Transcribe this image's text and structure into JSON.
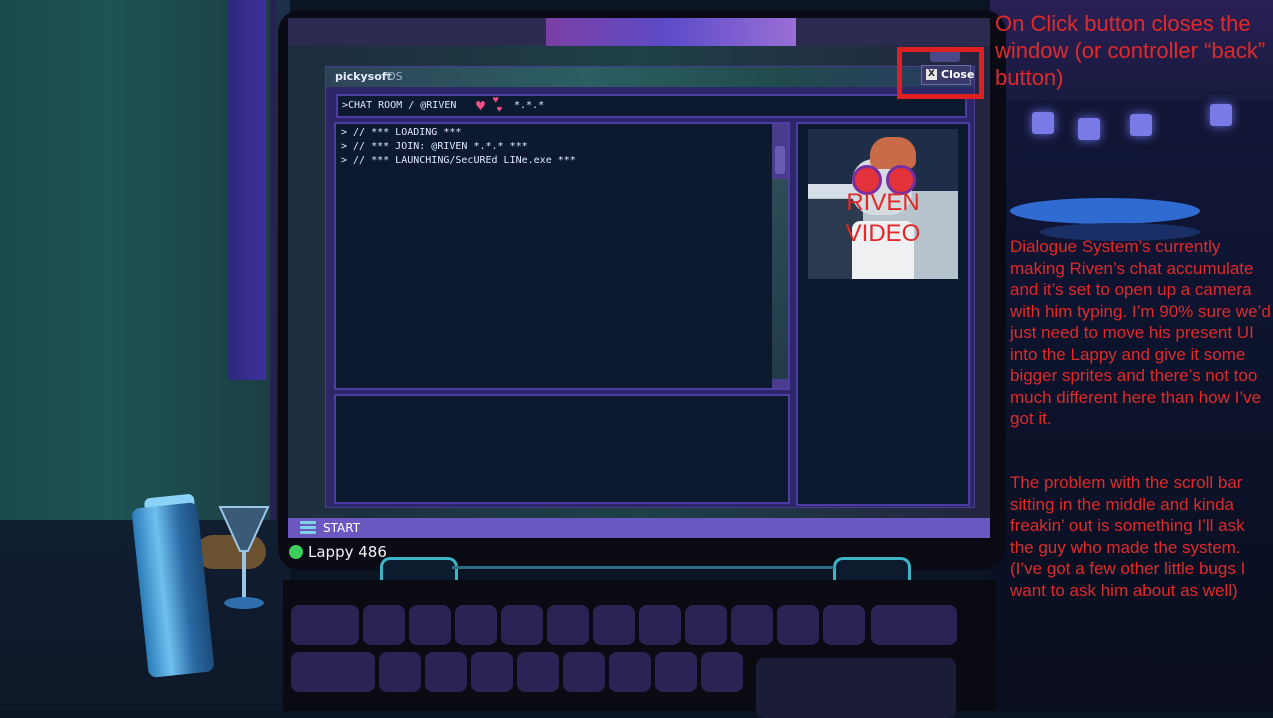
{
  "os": {
    "brand": "pickysoft",
    "brand_suffix": "OS",
    "close_key": "X",
    "close_label": "Close"
  },
  "chat": {
    "header_prefix": ">CHAT ROOM / @RIVEN",
    "header_suffix": "*.*.*",
    "log_lines": [
      "> // *** LOADING ***",
      "> // *** JOIN: @RIVEN *.*.* ***",
      "> // *** LAUNCHING/SecUREd LINe.exe ***"
    ],
    "input_value": ""
  },
  "video": {
    "label_line1": "RIVEN",
    "label_line2": "VIDEO"
  },
  "taskbar": {
    "start_label": "START"
  },
  "device": {
    "name": "Lappy 486",
    "status_color": "#3ccf5a"
  },
  "annotations": {
    "close_note": "On Click button closes the window (or controller “back” button)",
    "dialogue_note": "Dialogue System’s currently making Riven’s chat accumulate and it’s set to open up a camera with him typing. I’m 90% sure we’d just need to move his present UI into the Lappy and give it some bigger sprites and there’s not too much different here than how I’ve got it.",
    "scroll_note": "The problem with the scroll bar sitting in the middle and kinda freakin’ out is something I’ll ask the guy who made the system. (I’ve got a few other little bugs I want to ask him about as well)",
    "color": "#e02a2a"
  },
  "colors": {
    "taskbar": "#6a58c0",
    "window_border": "#4d3ca4",
    "panel_bg": "#0c1a30",
    "heart": "#f0508a"
  },
  "icons": [
    "close-x-icon",
    "heart-icon",
    "start-menu-icon",
    "status-dot-icon"
  ]
}
